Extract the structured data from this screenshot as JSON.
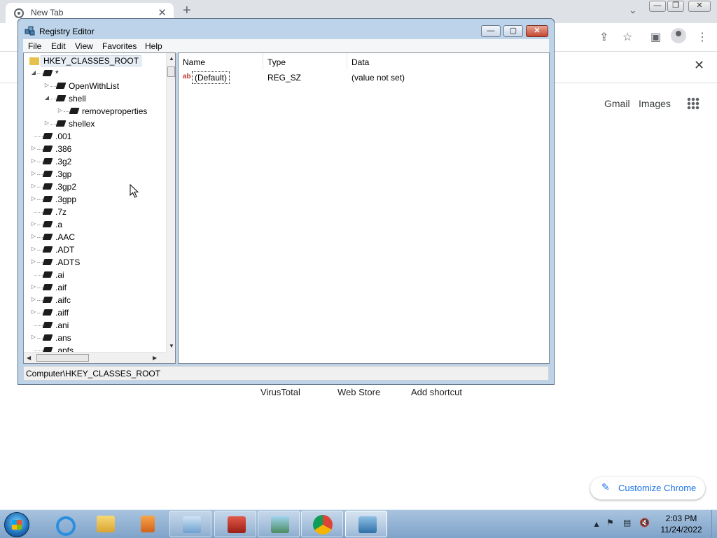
{
  "browser": {
    "tab_title": "New Tab",
    "tab_close": "✕",
    "new_tab": "+",
    "tab_search": "⌄",
    "window_controls": [
      "—",
      "❐",
      "✕"
    ],
    "infobar_close": "✕",
    "links": {
      "gmail": "Gmail",
      "images": "Images"
    },
    "shortcuts": [
      "VirusTotal",
      "Web Store",
      "Add shortcut"
    ],
    "customize_label": "Customize Chrome"
  },
  "regedit": {
    "title": "Registry Editor",
    "menu": [
      "File",
      "Edit",
      "View",
      "Favorites",
      "Help"
    ],
    "tree_root": "HKEY_CLASSES_ROOT",
    "tree_items": [
      {
        "label": "*",
        "expander": "◢"
      },
      {
        "label": "OpenWithList",
        "expander": "▷"
      },
      {
        "label": "shell",
        "expander": "◢"
      },
      {
        "label": "removeproperties",
        "expander": "▷"
      },
      {
        "label": "shellex",
        "expander": "▷"
      },
      {
        "label": ".001",
        "expander": ""
      },
      {
        "label": ".386",
        "expander": "▷"
      },
      {
        "label": ".3g2",
        "expander": "▷"
      },
      {
        "label": ".3gp",
        "expander": "▷"
      },
      {
        "label": ".3gp2",
        "expander": "▷"
      },
      {
        "label": ".3gpp",
        "expander": "▷"
      },
      {
        "label": ".7z",
        "expander": ""
      },
      {
        "label": ".a",
        "expander": "▷"
      },
      {
        "label": ".AAC",
        "expander": "▷"
      },
      {
        "label": ".ADT",
        "expander": "▷"
      },
      {
        "label": ".ADTS",
        "expander": "▷"
      },
      {
        "label": ".ai",
        "expander": ""
      },
      {
        "label": ".aif",
        "expander": "▷"
      },
      {
        "label": ".aifc",
        "expander": "▷"
      },
      {
        "label": ".aiff",
        "expander": "▷"
      },
      {
        "label": ".ani",
        "expander": ""
      },
      {
        "label": ".ans",
        "expander": "▷"
      },
      {
        "label": ".apfs",
        "expander": ""
      }
    ],
    "columns": {
      "name": "Name",
      "type": "Type",
      "data": "Data"
    },
    "values": [
      {
        "name": "(Default)",
        "type": "REG_SZ",
        "data": "(value not set)"
      }
    ],
    "status": "Computer\\HKEY_CLASSES_ROOT"
  },
  "taskbar": {
    "time": "2:03 PM",
    "date": "11/24/2022",
    "apps": [
      "internet-explorer",
      "file-explorer",
      "media-player",
      "control-panel",
      "toolbox",
      "photo-viewer",
      "chrome",
      "registry-editor"
    ]
  }
}
